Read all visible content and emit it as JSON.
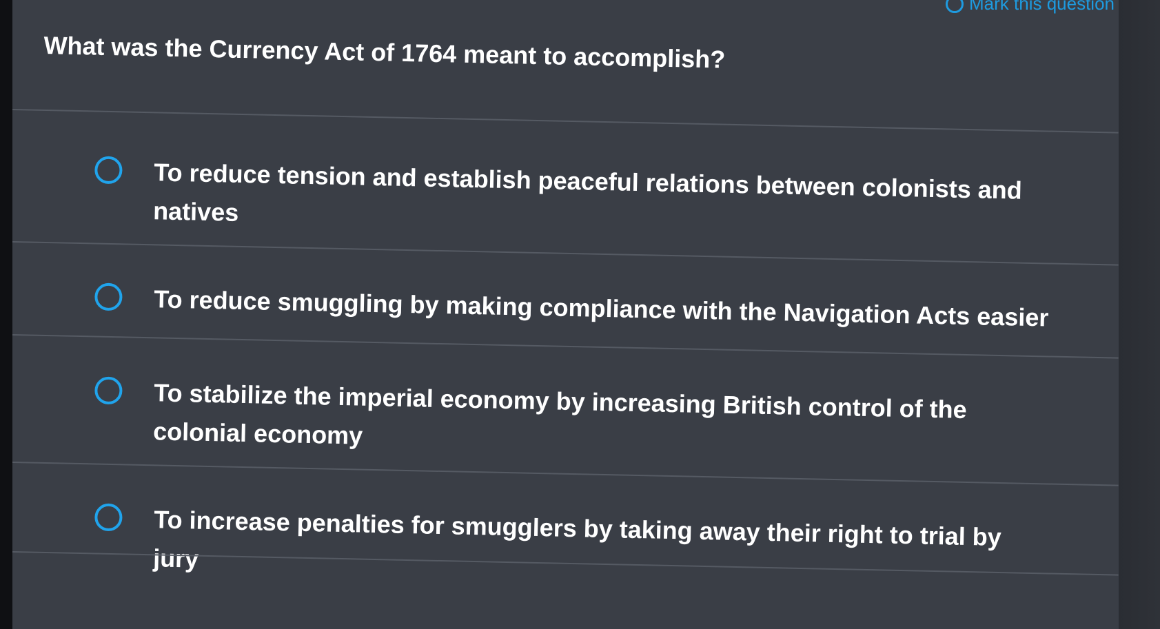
{
  "header": {
    "mark_label": "Mark this question"
  },
  "question": {
    "text": "What was the Currency Act of 1764 meant to accomplish?"
  },
  "options": [
    {
      "label": "To reduce tension and establish peaceful relations between colonists and natives",
      "selected": false
    },
    {
      "label": "To reduce smuggling by making compliance with the Navigation Acts easier",
      "selected": false
    },
    {
      "label": "To stabilize the imperial economy by increasing British control of the colonial economy",
      "selected": false
    },
    {
      "label": "To increase penalties for smugglers by taking away their right to trial by jury",
      "selected": false
    }
  ],
  "colors": {
    "accent": "#20a4ec",
    "panel": "#3a3e46",
    "text": "#ffffff"
  }
}
